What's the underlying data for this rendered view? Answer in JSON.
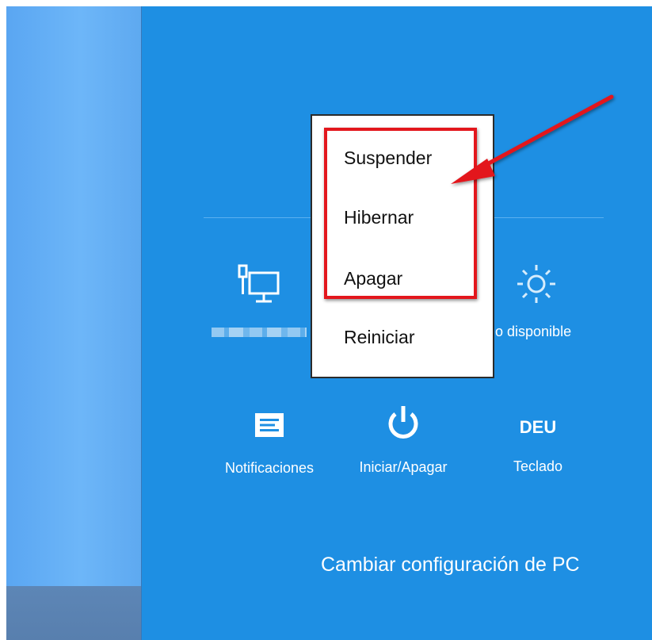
{
  "settings_panel": {
    "tiles": {
      "network": {
        "label": ""
      },
      "brightness": {
        "label": "o disponible"
      },
      "notifications": {
        "label": "Notificaciones"
      },
      "power": {
        "label": "Iniciar/Apagar"
      },
      "keyboard": {
        "code": "DEU",
        "label": "Teclado"
      }
    },
    "change_settings_link": "Cambiar configuración de PC"
  },
  "power_menu": {
    "items": [
      {
        "label": "Suspender"
      },
      {
        "label": "Hibernar"
      },
      {
        "label": "Apagar"
      },
      {
        "label": "Reiniciar"
      }
    ]
  },
  "annotation": {
    "highlight_color": "#e3171d",
    "arrow_color": "#e3171d"
  },
  "colors": {
    "panel_background": "#1e8fe3",
    "desktop_background": "#6db6f8",
    "taskbar": "#587fae"
  }
}
